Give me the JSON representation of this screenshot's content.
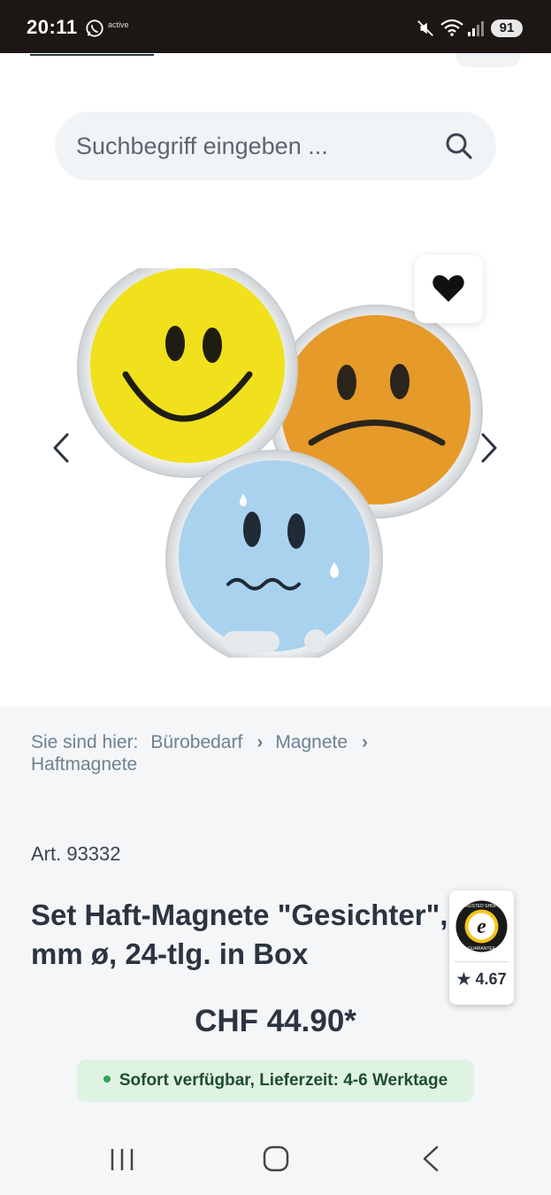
{
  "status_bar": {
    "time": "20:11",
    "active_label": "active",
    "battery": "91",
    "icons": [
      "whatsapp-icon",
      "mute-icon",
      "wifi-icon",
      "signal-icon",
      "battery-icon"
    ]
  },
  "search": {
    "placeholder": "Suchbegriff eingeben ..."
  },
  "gallery": {
    "image_alt": "Set Haft-Magnete Gesichter – smiley magnets",
    "favorite_icon": "heart-icon"
  },
  "breadcrumb": {
    "prefix": "Sie sind hier:",
    "items": [
      "Bürobedarf",
      "Magnete",
      "Haftmagnete"
    ]
  },
  "product": {
    "article": "Art. 93332",
    "title_line1": "Set Haft-Magnete \"Gesichter\", 25",
    "title_line2": "mm ø, 24-tlg. in Box",
    "price": "CHF 44.90*",
    "availability": "Sofort verfügbar, Lieferzeit: 4-6 Werktage"
  },
  "trusted_shops": {
    "seal_letter": "e",
    "seal_top": "TRUSTED SHOPS",
    "seal_bottom": "GUARANTEE",
    "rating": "★ 4.67"
  },
  "colors": {
    "status_bg": "#1c1714",
    "text_dark": "#2b3440",
    "breadcrumb": "#6d8193",
    "availability_bg": "#dff3e4",
    "availability_dot": "#2fa65a"
  }
}
